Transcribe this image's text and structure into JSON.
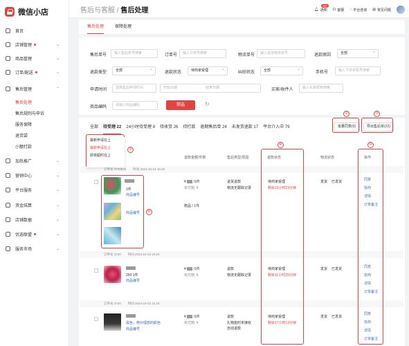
{
  "app": {
    "name": "微信小店"
  },
  "breadcrumb": {
    "parent": "售后与客服 /",
    "current": "售后处理"
  },
  "topbar": {
    "notice": "通知",
    "notice_badge": "99+",
    "service": "客服",
    "platform": "平台咨询",
    "faq": "常见问题"
  },
  "sidebar": {
    "home": "首页",
    "shop": "店铺管理",
    "goods": "商品管理",
    "orders": "订单/配送",
    "aftersale": "售后管理",
    "sub": [
      "售后处理",
      "售后规则与申诉",
      "服务保障",
      "退货袋",
      "小额打款"
    ],
    "promo": "加热推广",
    "marketing": "营销中心",
    "platform": "平台服务",
    "finance": "资金结算",
    "data": "店铺数据",
    "union": "优选联盟",
    "market": "服务市场"
  },
  "tabs": [
    "售后处理",
    "保障处理"
  ],
  "filters": {
    "aftersale_no": "售后单号",
    "aftersale_no_ph": "输入售后单号搜索",
    "order_no": "订单号",
    "order_no_ph": "输入订单号搜索",
    "logistics_no": "物流单号",
    "logistics_no_ph": "输入退货物流单号",
    "reason": "退款原因",
    "reason_val": "全部",
    "refund_type": "退款类型",
    "refund_type_val": "全部",
    "refund_status": "退款状态",
    "refund_status_val": "待商家受理",
    "dispute": "纠纷状态",
    "dispute_val": "全部",
    "phone": "手机号",
    "phone_ph": "输入下单手机号搜索",
    "apply_time": "申请时间",
    "apply_time_ph": "选择售后申请时间",
    "start_date": "开始日期",
    "arrow": "→",
    "end_date": "结束日期",
    "buyer": "买家/收件人",
    "buyer_ph": "输入买家昵称搜索",
    "goods_code": "商品编码",
    "goods_code_ph": "请输入商品编码",
    "filter_btn": "筛选"
  },
  "status_tabs": [
    "全部",
    "待受理 22",
    "24小时待受理 8",
    "待收货 26",
    "待打款",
    "逾期售后单 24",
    "未发货退款 17",
    "平台介入中 79"
  ],
  "actions": {
    "batch": "批量同意(0)",
    "export": "导出售后单(22)"
  },
  "dropdown": [
    "最新申请在上",
    "最新申请在上",
    "即将超时在上"
  ],
  "columns": {
    "amount": "退款金额/件数",
    "type": "售后类型/原因",
    "status": "退款状态",
    "logistics": "物流状态",
    "ops": "操作"
  },
  "orders": [
    {
      "head": "订单号 3720826",
      "time": "时间 2024-10-24 10:20",
      "item_qty": "1件",
      "code_label": "商品编号",
      "price": "¥",
      "qty": "/1件",
      "paid": "实付款: ¥",
      "gift": "赠品 / 1件",
      "gift_code": "商品编号",
      "type": "退货退款",
      "reason": "物流无跟踪记录",
      "status": "待商家受理",
      "remain": "剩余23小时23分钟",
      "ship": "发货",
      "ship_state": "已发货",
      "ops": [
        "同意",
        "协商",
        "详情",
        "订单备注"
      ]
    },
    {
      "head": "订单号 3720",
      "time": "时间 2024-10-23 10:20",
      "item_qty": "250 1件",
      "code_label": "商品编号",
      "price": "¥",
      "qty": "/1件",
      "paid": "实付款: ¥",
      "type": "退款",
      "reason": "物流无跟踪记录",
      "status": "待商家受理",
      "remain": "剩余11小时29分钟",
      "ship": "发货",
      "ship_state": "已发货",
      "ops": [
        "同意",
        "协商",
        "详情",
        "订单备注"
      ]
    },
    {
      "head": "订单号 3720",
      "time": "时间 2024-10-23 10:20",
      "item_qty": "黑色，绝对理想的颜色",
      "code_label": "商品编号",
      "price": "¥",
      "qty": "/1件",
      "paid": "实付款: ¥",
      "type": "退款",
      "reason": "礼物能时未接收",
      "reason2": "自动退款",
      "status": "待商家受理",
      "remain": "剩余17小时13分钟",
      "ship": "发货",
      "ship_state": "已发货",
      "ops": [
        "同意",
        "协商",
        "详情",
        "订单备注"
      ]
    }
  ],
  "annotations": [
    "①",
    "②",
    "③",
    "④",
    "⑤",
    "⑥"
  ],
  "colors": {
    "accent": "#e64340",
    "link": "#3a6fc4"
  }
}
